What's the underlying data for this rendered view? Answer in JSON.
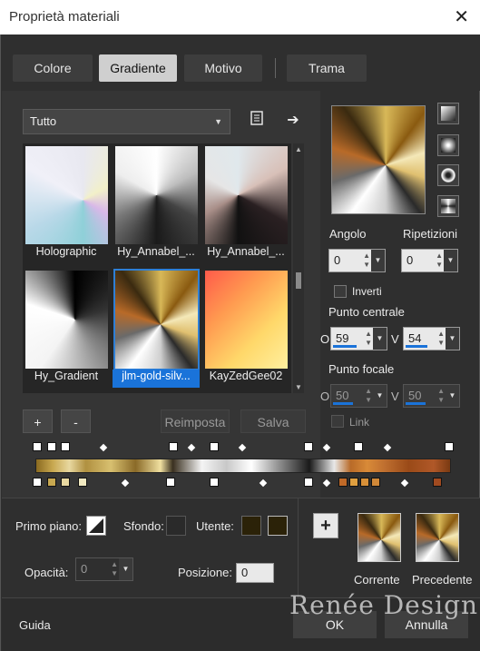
{
  "window": {
    "title": "Proprietà materiali",
    "close_icon": "close-icon"
  },
  "tabs": [
    {
      "label": "Colore"
    },
    {
      "label": "Gradiente"
    },
    {
      "label": "Motivo"
    },
    {
      "label": "Trama"
    }
  ],
  "library": {
    "category": "Tutto",
    "items": [
      {
        "label": "Holographic"
      },
      {
        "label": "Hy_Annabel_..."
      },
      {
        "label": "Hy_Annabel_..."
      },
      {
        "label": "Hy_Gradient"
      },
      {
        "label": "jlm-gold-silv...",
        "selected": true
      },
      {
        "label": "KayZedGee02"
      }
    ],
    "add_label": "+",
    "remove_label": "-",
    "reset_label": "Reimposta",
    "save_label": "Salva"
  },
  "settings": {
    "angle_label": "Angolo",
    "angle_value": "0",
    "repeat_label": "Ripetizioni",
    "repeat_value": "0",
    "invert_label": "Inverti",
    "center_label": "Punto centrale",
    "center_h_prefix": "O",
    "center_h_value": "59",
    "center_v_prefix": "V",
    "center_v_value": "54",
    "focal_label": "Punto focale",
    "focal_h_prefix": "O",
    "focal_h_value": "50",
    "focal_v_prefix": "V",
    "focal_v_value": "50",
    "link_label": "Link"
  },
  "footer": {
    "foreground_label": "Primo piano:",
    "background_label": "Sfondo:",
    "user_label": "Utente:",
    "user_color": "#2b2208",
    "opacity_label": "Opacità:",
    "opacity_value": "0",
    "position_label": "Posizione:",
    "position_value": "0",
    "current_label": "Corrente",
    "previous_label": "Precedente",
    "help_label": "Guida",
    "ok_label": "OK",
    "cancel_label": "Annulla",
    "watermark": "Renée Design"
  },
  "colors": {
    "accent": "#1a73d9",
    "panel": "#353535"
  }
}
